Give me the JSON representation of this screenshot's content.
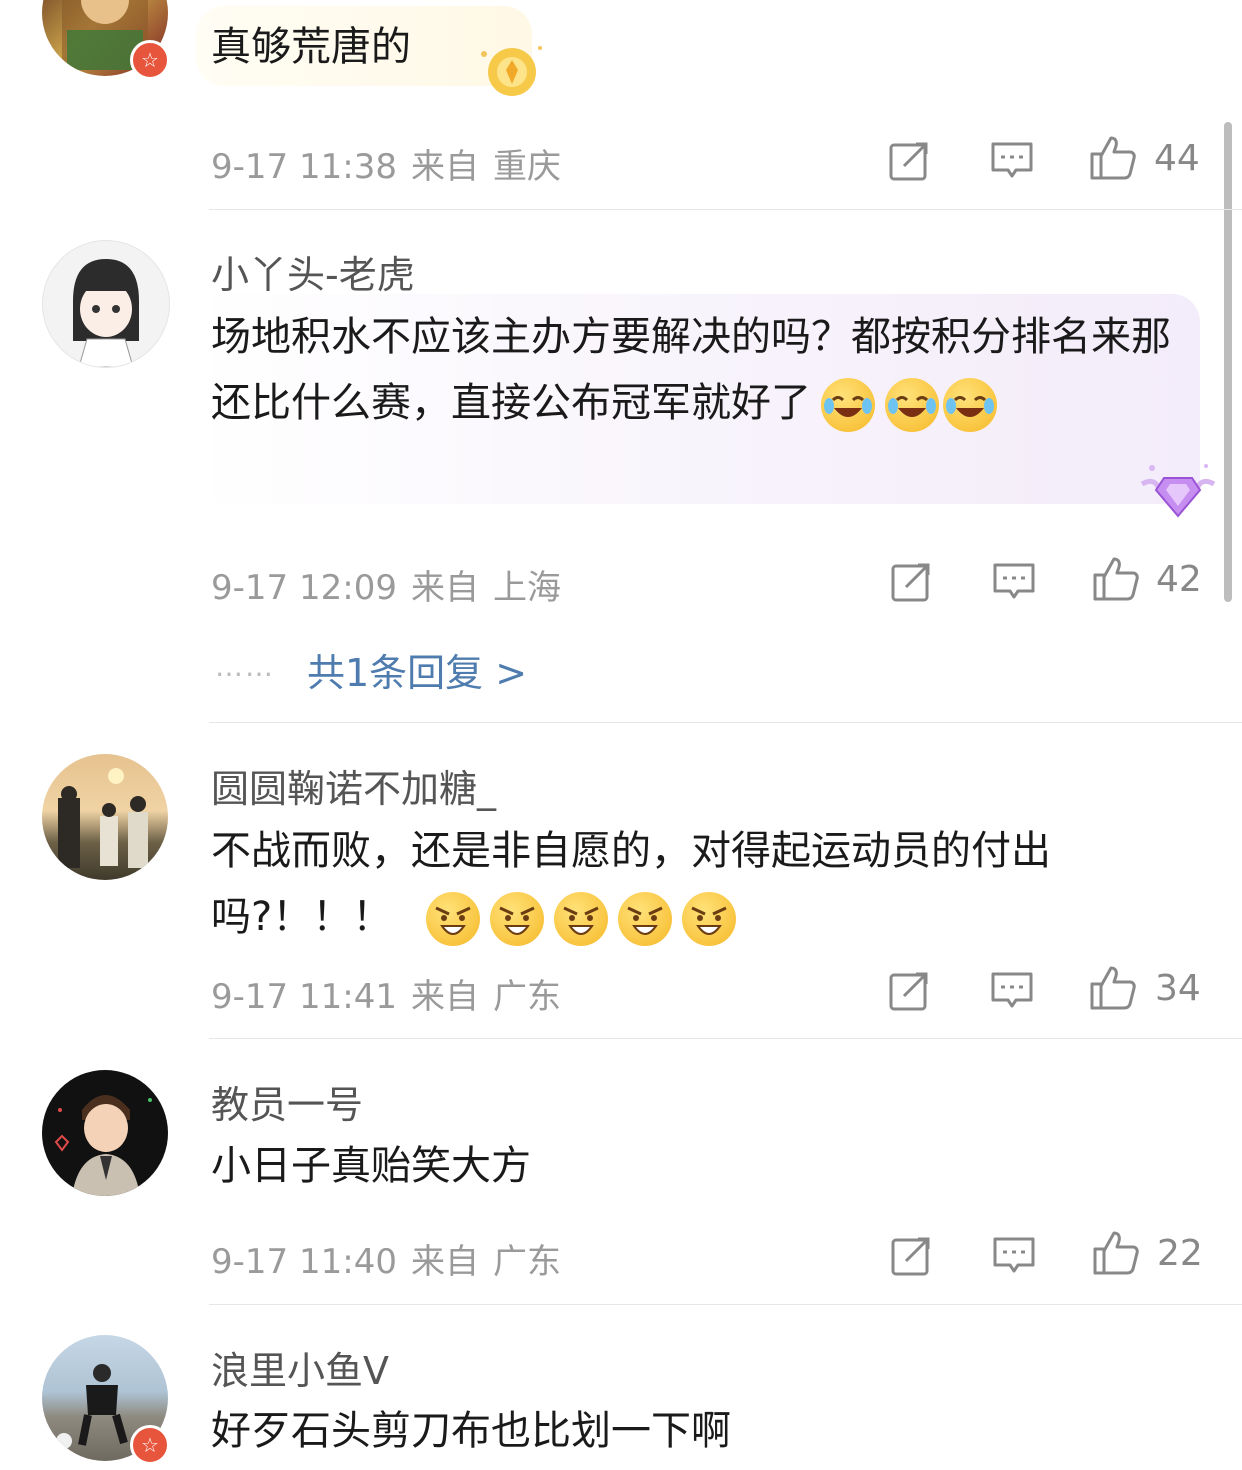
{
  "comments": [
    {
      "username": "",
      "text": "真够荒唐的",
      "date": "9-17 11:38",
      "from_label": "来自",
      "location": "重庆",
      "likes": "44",
      "vip": true
    },
    {
      "username": "小丫头-老虎",
      "text": "场地积水不应该主办方要解决的吗？都按积分排名来那还比什么赛，直接公布冠军就好了",
      "emoji": "laugh-cry",
      "emoji_count": 3,
      "date": "9-17 12:09",
      "from_label": "来自",
      "location": "上海",
      "likes": "42",
      "replies_dots": "……",
      "replies_label": "共1条回复 >"
    },
    {
      "username": "圆圆鞠诺不加糖_",
      "text": "不战而败，还是非自愿的，对得起运动员的付出吗?！！！",
      "emoji": "angry",
      "emoji_count": 5,
      "date": "9-17 11:41",
      "from_label": "来自",
      "location": "广东",
      "likes": "34"
    },
    {
      "username": "教员一号",
      "text": "小日子真贻笑大方",
      "date": "9-17 11:40",
      "from_label": "来自",
      "location": "广东",
      "likes": "22"
    },
    {
      "username": "浪里小鱼V",
      "text": "好歹石头剪刀布也比划一下啊",
      "vip": true
    }
  ],
  "icons": {
    "share": "share-icon",
    "comment": "comment-icon",
    "like": "thumbs-up-icon",
    "vip_badge": "star-badge-icon"
  },
  "colors": {
    "link": "#4f7cae",
    "meta": "#9a9a9a",
    "vip_badge": "#e8553d"
  }
}
